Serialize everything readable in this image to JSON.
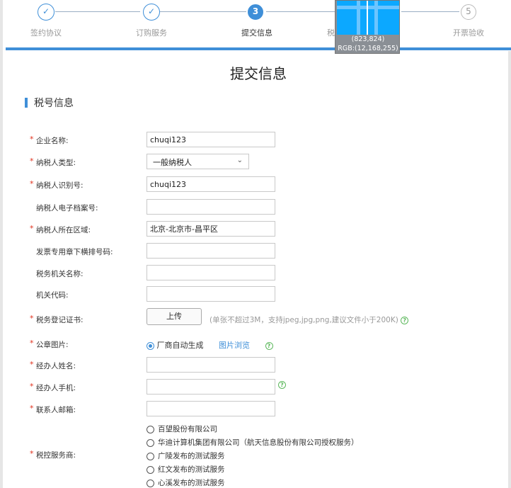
{
  "steps": [
    {
      "label": "签约协议",
      "status": "done"
    },
    {
      "label": "订购服务",
      "status": "done"
    },
    {
      "label": "提交信息",
      "number": "3",
      "status": "active"
    },
    {
      "label": "税",
      "status": "hidden"
    },
    {
      "label": "开票验收",
      "number": "5",
      "status": "pending"
    }
  ],
  "picker": {
    "coords": "(823,824)",
    "rgb": "RGB:(12,168,255)",
    "color": "#0ca8ff"
  },
  "page_title": "提交信息",
  "section_title": "税号信息",
  "form": {
    "company_name": {
      "label": "企业名称:",
      "value": "chuqi123"
    },
    "taxpayer_type": {
      "label": "纳税人类型:",
      "value": "一般纳税人"
    },
    "taxpayer_id": {
      "label": "纳税人识别号:",
      "value": "chuqi123"
    },
    "e_archive_no": {
      "label": "纳税人电子档案号:",
      "value": ""
    },
    "region": {
      "label": "纳税人所在区域:",
      "value": "北京-北京市-昌平区"
    },
    "invoice_seal_no": {
      "label": "发票专用章下横排号码:",
      "value": ""
    },
    "tax_authority_name": {
      "label": "税务机关名称:",
      "value": ""
    },
    "authority_code": {
      "label": "机关代码:",
      "value": ""
    },
    "tax_certificate": {
      "label": "税务登记证书:",
      "button": "上传",
      "hint": "(单张不超过3M，支持jpeg,jpg,png,建议文件小于200K)"
    },
    "seal_image": {
      "label": "公章图片:",
      "option": "厂商自动生成",
      "link": "图片浏览"
    },
    "agent_name": {
      "label": "经办人姓名:",
      "value": ""
    },
    "agent_phone": {
      "label": "经办人手机:",
      "value": ""
    },
    "contact_email": {
      "label": "联系人邮箱:",
      "value": ""
    },
    "tax_service_provider": {
      "label": "税控服务商:",
      "options": [
        "百望股份有限公司",
        "华迪计算机集团有限公司（航天信息股份有限公司授权服务）",
        "广陵发布的测试服务",
        "红文发布的测试服务",
        "心溪发布的测试服务"
      ]
    }
  },
  "help_glyph": "?"
}
